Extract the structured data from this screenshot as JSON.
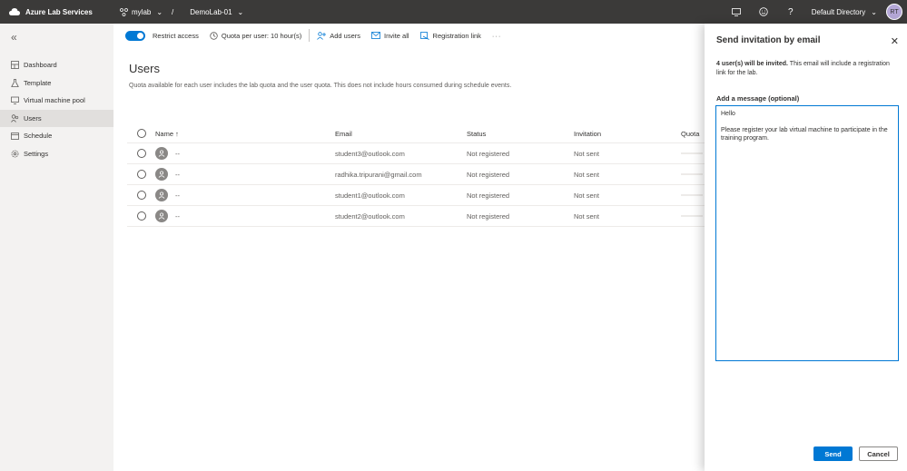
{
  "topbar": {
    "app_name": "Azure Lab Services",
    "lab_plan": "mylab",
    "separator": "/",
    "lab_name": "DemoLab-01",
    "directory": "Default Directory",
    "avatar_initials": "RT"
  },
  "sidebar": {
    "items": [
      {
        "label": "Dashboard",
        "icon": "dashboard-icon"
      },
      {
        "label": "Template",
        "icon": "template-flask-icon"
      },
      {
        "label": "Virtual machine pool",
        "icon": "vm-pool-icon"
      },
      {
        "label": "Users",
        "icon": "users-icon",
        "active": true
      },
      {
        "label": "Schedule",
        "icon": "schedule-icon"
      },
      {
        "label": "Settings",
        "icon": "settings-gear-icon"
      }
    ]
  },
  "commandbar": {
    "restrict_access": "Restrict access",
    "quota": "Quota per user: 10 hour(s)",
    "add_users": "Add users",
    "invite_all": "Invite all",
    "registration_link": "Registration link",
    "more": "···"
  },
  "main": {
    "title": "Users",
    "description": "Quota available for each user includes the lab quota and the user quota. This does not include hours consumed during schedule events.",
    "columns": {
      "name": "Name ↑",
      "email": "Email",
      "status": "Status",
      "invitation": "Invitation",
      "quota": "Quota"
    },
    "rows": [
      {
        "name": "--",
        "email": "student3@outlook.com",
        "status": "Not registered",
        "invitation": "Not sent"
      },
      {
        "name": "--",
        "email": "radhika.tripurani@gmail.com",
        "status": "Not registered",
        "invitation": "Not sent"
      },
      {
        "name": "--",
        "email": "student1@outlook.com",
        "status": "Not registered",
        "invitation": "Not sent"
      },
      {
        "name": "--",
        "email": "student2@outlook.com",
        "status": "Not registered",
        "invitation": "Not sent"
      }
    ]
  },
  "panel": {
    "title": "Send invitation by email",
    "info_bold": "4 user(s) will be invited.",
    "info_rest": " This email will include a registration link for the lab.",
    "message_label": "Add a message (optional)",
    "message_line1": "Hello",
    "message_line2": "Please register your lab virtual machine to participate in the training program.",
    "send": "Send",
    "cancel": "Cancel"
  },
  "colors": {
    "accent": "#0078d4",
    "topbar": "#3b3a39",
    "sidebar": "#f3f2f1"
  }
}
